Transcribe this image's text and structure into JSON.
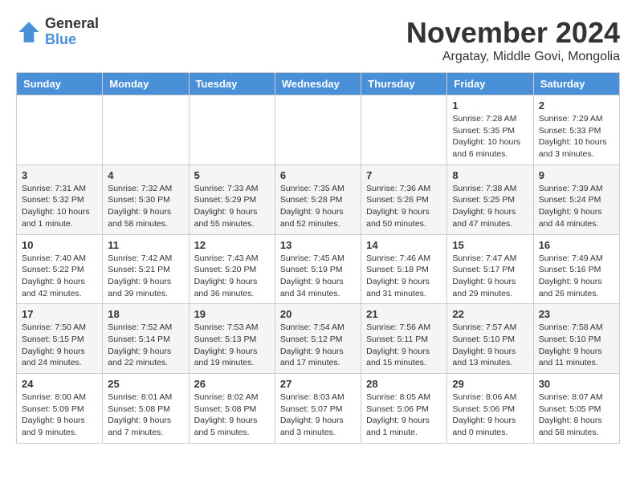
{
  "logo": {
    "general": "General",
    "blue": "Blue"
  },
  "title": "November 2024",
  "subtitle": "Argatay, Middle Govi, Mongolia",
  "headers": [
    "Sunday",
    "Monday",
    "Tuesday",
    "Wednesday",
    "Thursday",
    "Friday",
    "Saturday"
  ],
  "weeks": [
    [
      {
        "day": "",
        "info": ""
      },
      {
        "day": "",
        "info": ""
      },
      {
        "day": "",
        "info": ""
      },
      {
        "day": "",
        "info": ""
      },
      {
        "day": "",
        "info": ""
      },
      {
        "day": "1",
        "info": "Sunrise: 7:28 AM\nSunset: 5:35 PM\nDaylight: 10 hours\nand 6 minutes."
      },
      {
        "day": "2",
        "info": "Sunrise: 7:29 AM\nSunset: 5:33 PM\nDaylight: 10 hours\nand 3 minutes."
      }
    ],
    [
      {
        "day": "3",
        "info": "Sunrise: 7:31 AM\nSunset: 5:32 PM\nDaylight: 10 hours\nand 1 minute."
      },
      {
        "day": "4",
        "info": "Sunrise: 7:32 AM\nSunset: 5:30 PM\nDaylight: 9 hours\nand 58 minutes."
      },
      {
        "day": "5",
        "info": "Sunrise: 7:33 AM\nSunset: 5:29 PM\nDaylight: 9 hours\nand 55 minutes."
      },
      {
        "day": "6",
        "info": "Sunrise: 7:35 AM\nSunset: 5:28 PM\nDaylight: 9 hours\nand 52 minutes."
      },
      {
        "day": "7",
        "info": "Sunrise: 7:36 AM\nSunset: 5:26 PM\nDaylight: 9 hours\nand 50 minutes."
      },
      {
        "day": "8",
        "info": "Sunrise: 7:38 AM\nSunset: 5:25 PM\nDaylight: 9 hours\nand 47 minutes."
      },
      {
        "day": "9",
        "info": "Sunrise: 7:39 AM\nSunset: 5:24 PM\nDaylight: 9 hours\nand 44 minutes."
      }
    ],
    [
      {
        "day": "10",
        "info": "Sunrise: 7:40 AM\nSunset: 5:22 PM\nDaylight: 9 hours\nand 42 minutes."
      },
      {
        "day": "11",
        "info": "Sunrise: 7:42 AM\nSunset: 5:21 PM\nDaylight: 9 hours\nand 39 minutes."
      },
      {
        "day": "12",
        "info": "Sunrise: 7:43 AM\nSunset: 5:20 PM\nDaylight: 9 hours\nand 36 minutes."
      },
      {
        "day": "13",
        "info": "Sunrise: 7:45 AM\nSunset: 5:19 PM\nDaylight: 9 hours\nand 34 minutes."
      },
      {
        "day": "14",
        "info": "Sunrise: 7:46 AM\nSunset: 5:18 PM\nDaylight: 9 hours\nand 31 minutes."
      },
      {
        "day": "15",
        "info": "Sunrise: 7:47 AM\nSunset: 5:17 PM\nDaylight: 9 hours\nand 29 minutes."
      },
      {
        "day": "16",
        "info": "Sunrise: 7:49 AM\nSunset: 5:16 PM\nDaylight: 9 hours\nand 26 minutes."
      }
    ],
    [
      {
        "day": "17",
        "info": "Sunrise: 7:50 AM\nSunset: 5:15 PM\nDaylight: 9 hours\nand 24 minutes."
      },
      {
        "day": "18",
        "info": "Sunrise: 7:52 AM\nSunset: 5:14 PM\nDaylight: 9 hours\nand 22 minutes."
      },
      {
        "day": "19",
        "info": "Sunrise: 7:53 AM\nSunset: 5:13 PM\nDaylight: 9 hours\nand 19 minutes."
      },
      {
        "day": "20",
        "info": "Sunrise: 7:54 AM\nSunset: 5:12 PM\nDaylight: 9 hours\nand 17 minutes."
      },
      {
        "day": "21",
        "info": "Sunrise: 7:56 AM\nSunset: 5:11 PM\nDaylight: 9 hours\nand 15 minutes."
      },
      {
        "day": "22",
        "info": "Sunrise: 7:57 AM\nSunset: 5:10 PM\nDaylight: 9 hours\nand 13 minutes."
      },
      {
        "day": "23",
        "info": "Sunrise: 7:58 AM\nSunset: 5:10 PM\nDaylight: 9 hours\nand 11 minutes."
      }
    ],
    [
      {
        "day": "24",
        "info": "Sunrise: 8:00 AM\nSunset: 5:09 PM\nDaylight: 9 hours\nand 9 minutes."
      },
      {
        "day": "25",
        "info": "Sunrise: 8:01 AM\nSunset: 5:08 PM\nDaylight: 9 hours\nand 7 minutes."
      },
      {
        "day": "26",
        "info": "Sunrise: 8:02 AM\nSunset: 5:08 PM\nDaylight: 9 hours\nand 5 minutes."
      },
      {
        "day": "27",
        "info": "Sunrise: 8:03 AM\nSunset: 5:07 PM\nDaylight: 9 hours\nand 3 minutes."
      },
      {
        "day": "28",
        "info": "Sunrise: 8:05 AM\nSunset: 5:06 PM\nDaylight: 9 hours\nand 1 minute."
      },
      {
        "day": "29",
        "info": "Sunrise: 8:06 AM\nSunset: 5:06 PM\nDaylight: 9 hours\nand 0 minutes."
      },
      {
        "day": "30",
        "info": "Sunrise: 8:07 AM\nSunset: 5:05 PM\nDaylight: 8 hours\nand 58 minutes."
      }
    ]
  ]
}
